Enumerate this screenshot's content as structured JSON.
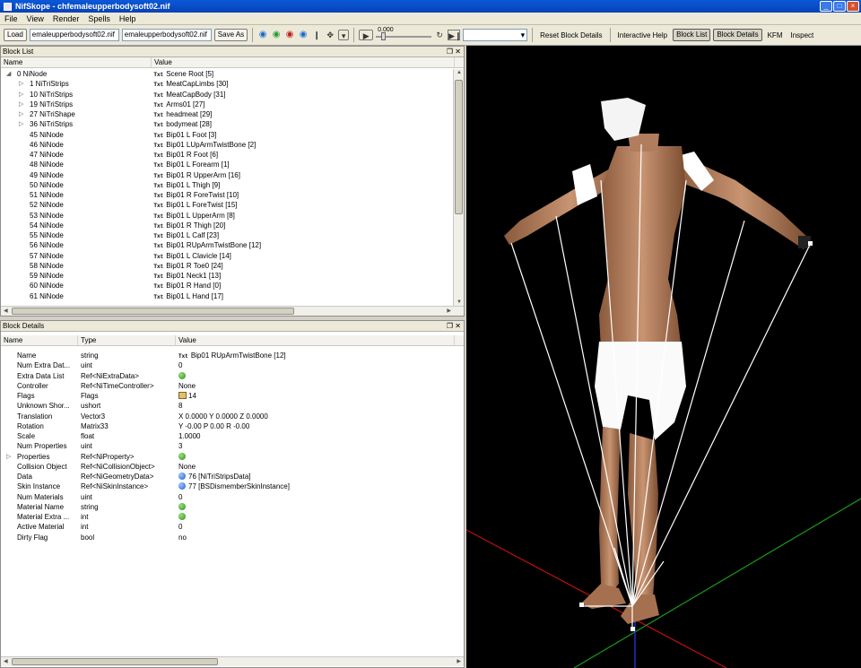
{
  "window": {
    "title": "NifSkope - chfemaleupperbodysoft02.nif"
  },
  "menu": [
    "File",
    "View",
    "Render",
    "Spells",
    "Help"
  ],
  "toolbar": {
    "load_label": "Load",
    "load_path": "emaleupperbodysoft02.nif",
    "save_path": "emaleupperbodysoft02.nif",
    "save_label": "Save As",
    "time_value": "0.000",
    "reset_label": "Reset Block Details",
    "help_label": "Interactive Help",
    "blocklist_label": "Block List",
    "blockdetails_label": "Block Details",
    "kfm_label": "KFM",
    "inspect_label": "Inspect"
  },
  "block_list": {
    "title": "Block List",
    "columns": [
      "Name",
      "Value"
    ],
    "rows": [
      {
        "name": "0 NiNode",
        "value": "Scene Root [5]",
        "depth": 0,
        "expanded": true
      },
      {
        "name": "1 NiTriStrips",
        "value": "MeatCapLimbs [30]",
        "depth": 1,
        "expandable": true
      },
      {
        "name": "10 NiTriStrips",
        "value": "MeatCapBody [31]",
        "depth": 1,
        "expandable": true
      },
      {
        "name": "19 NiTriStrips",
        "value": "Arms01 [27]",
        "depth": 1,
        "expandable": true
      },
      {
        "name": "27 NiTriShape",
        "value": "headmeat [29]",
        "depth": 1,
        "expandable": true
      },
      {
        "name": "36 NiTriStrips",
        "value": "bodymeat [28]",
        "depth": 1,
        "expandable": true
      },
      {
        "name": "45 NiNode",
        "value": "Bip01 L Foot [3]",
        "depth": 1
      },
      {
        "name": "46 NiNode",
        "value": "Bip01 LUpArmTwistBone [2]",
        "depth": 1
      },
      {
        "name": "47 NiNode",
        "value": "Bip01 R Foot [6]",
        "depth": 1
      },
      {
        "name": "48 NiNode",
        "value": "Bip01 L Forearm [1]",
        "depth": 1
      },
      {
        "name": "49 NiNode",
        "value": "Bip01 R UpperArm [16]",
        "depth": 1
      },
      {
        "name": "50 NiNode",
        "value": "Bip01 L Thigh [9]",
        "depth": 1
      },
      {
        "name": "51 NiNode",
        "value": "Bip01 R ForeTwist [10]",
        "depth": 1
      },
      {
        "name": "52 NiNode",
        "value": "Bip01 L ForeTwist [15]",
        "depth": 1
      },
      {
        "name": "53 NiNode",
        "value": "Bip01 L UpperArm [8]",
        "depth": 1
      },
      {
        "name": "54 NiNode",
        "value": "Bip01 R Thigh [20]",
        "depth": 1
      },
      {
        "name": "55 NiNode",
        "value": "Bip01 L Calf [23]",
        "depth": 1
      },
      {
        "name": "56 NiNode",
        "value": "Bip01 RUpArmTwistBone [12]",
        "depth": 1
      },
      {
        "name": "57 NiNode",
        "value": "Bip01 L Clavicle [14]",
        "depth": 1
      },
      {
        "name": "58 NiNode",
        "value": "Bip01 R Toe0 [24]",
        "depth": 1
      },
      {
        "name": "59 NiNode",
        "value": "Bip01 Neck1 [13]",
        "depth": 1
      },
      {
        "name": "60 NiNode",
        "value": "Bip01 R Hand [0]",
        "depth": 1
      },
      {
        "name": "61 NiNode",
        "value": "Bip01 L Hand [17]",
        "depth": 1
      }
    ]
  },
  "block_details": {
    "title": "Block Details",
    "columns": [
      "Name",
      "Type",
      "Value"
    ],
    "rows": [
      {
        "name": "Name",
        "type": "string",
        "value": "Bip01 RUpArmTwistBone [12]",
        "icon": "txt"
      },
      {
        "name": "Num Extra Dat...",
        "type": "uint",
        "value": "0"
      },
      {
        "name": "Extra Data List",
        "type": "Ref<NiExtraData>",
        "value": "",
        "icon": "green"
      },
      {
        "name": "Controller",
        "type": "Ref<NiTimeController>",
        "value": "None"
      },
      {
        "name": "Flags",
        "type": "Flags",
        "value": "14",
        "icon": "flag"
      },
      {
        "name": "Unknown Shor...",
        "type": "ushort",
        "value": "8"
      },
      {
        "name": "Translation",
        "type": "Vector3",
        "value": "X 0.0000 Y 0.0000 Z 0.0000"
      },
      {
        "name": "Rotation",
        "type": "Matrix33",
        "value": "Y -0.00 P 0.00 R -0.00"
      },
      {
        "name": "Scale",
        "type": "float",
        "value": "1.0000"
      },
      {
        "name": "Num Properties",
        "type": "uint",
        "value": "3"
      },
      {
        "name": "Properties",
        "type": "Ref<NiProperty>",
        "value": "",
        "icon": "green",
        "expandable": true
      },
      {
        "name": "Collision Object",
        "type": "Ref<NiCollisionObject>",
        "value": "None"
      },
      {
        "name": "Data",
        "type": "Ref<NiGeometryData>",
        "value": "76 [NiTriStripsData]",
        "icon": "blue"
      },
      {
        "name": "Skin Instance",
        "type": "Ref<NiSkinInstance>",
        "value": "77 [BSDismemberSkinInstance]",
        "icon": "blue"
      },
      {
        "name": "Num Materials",
        "type": "uint",
        "value": "0"
      },
      {
        "name": "Material Name",
        "type": "string",
        "value": "",
        "icon": "green"
      },
      {
        "name": "Material Extra ...",
        "type": "int",
        "value": "",
        "icon": "green"
      },
      {
        "name": "Active Material",
        "type": "int",
        "value": "0"
      },
      {
        "name": "Dirty Flag",
        "type": "bool",
        "value": "no"
      }
    ]
  },
  "icons": {
    "txt_tag": "Txt",
    "play": "▶",
    "refresh": "↻"
  }
}
